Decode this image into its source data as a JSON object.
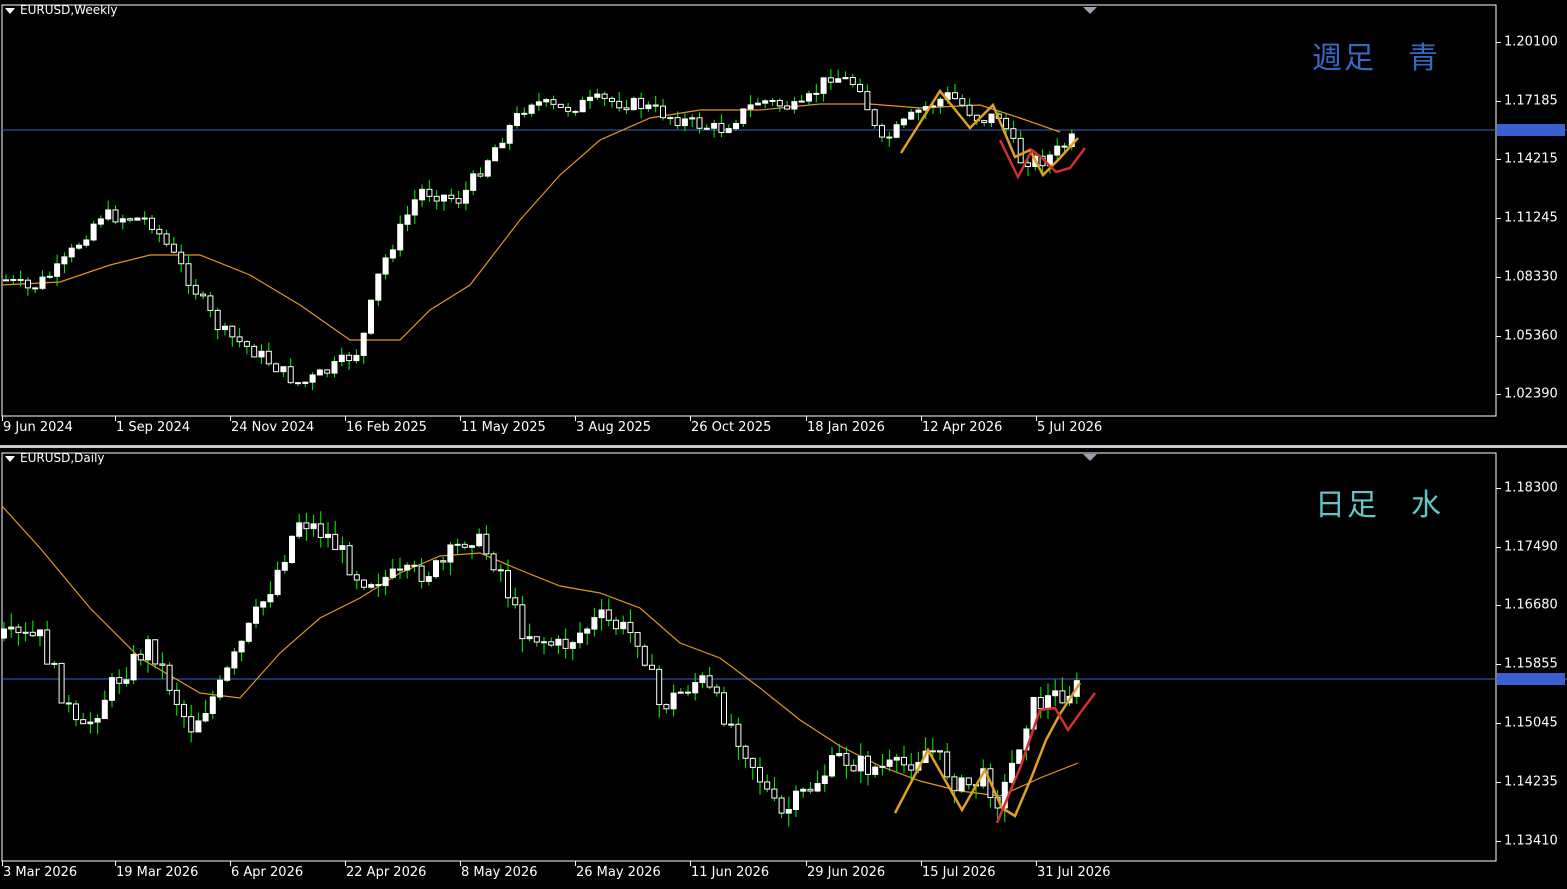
{
  "top_chart": {
    "title": "EURUSD,Weekly",
    "annotation": "週足　青",
    "annotation_color": "#3a66c4",
    "y_labels": [
      "1.20100",
      "1.17185",
      "1.14215",
      "1.11245",
      "1.08330",
      "1.05360",
      "1.02390"
    ],
    "x_labels": [
      "9 Jun 2024",
      "1 Sep 2024",
      "24 Nov 2024",
      "16 Feb 2025",
      "11 May 2025",
      "3 Aug 2025",
      "26 Oct 2025",
      "18 Jan 2026",
      "12 Apr 2026",
      "5 Jul 2026"
    ],
    "current_price": "1.15300"
  },
  "bottom_chart": {
    "title": "EURUSD,Daily",
    "annotation": "日足　水",
    "annotation_color": "#5ec8c8",
    "y_labels": [
      "1.18300",
      "1.17490",
      "1.16680",
      "1.15855",
      "1.15045",
      "1.14235",
      "1.13410"
    ],
    "x_labels": [
      "3 Mar 2026",
      "19 Mar 2026",
      "6 Apr 2026",
      "22 Apr 2026",
      "8 May 2026",
      "26 May 2026",
      "11 Jun 2026",
      "29 Jun 2026",
      "15 Jul 2026",
      "31 Jul 2026"
    ],
    "current_price": "1.15654"
  },
  "colors": {
    "background": "#000000",
    "bull_candle": "#ffffff",
    "bear_candle": "#ffffff",
    "wick": "#00ff00",
    "moving_average": "#e6961e",
    "price_line": "#3a5fd0",
    "trend_orange": "#e0a020",
    "trend_red": "#d03030"
  }
}
